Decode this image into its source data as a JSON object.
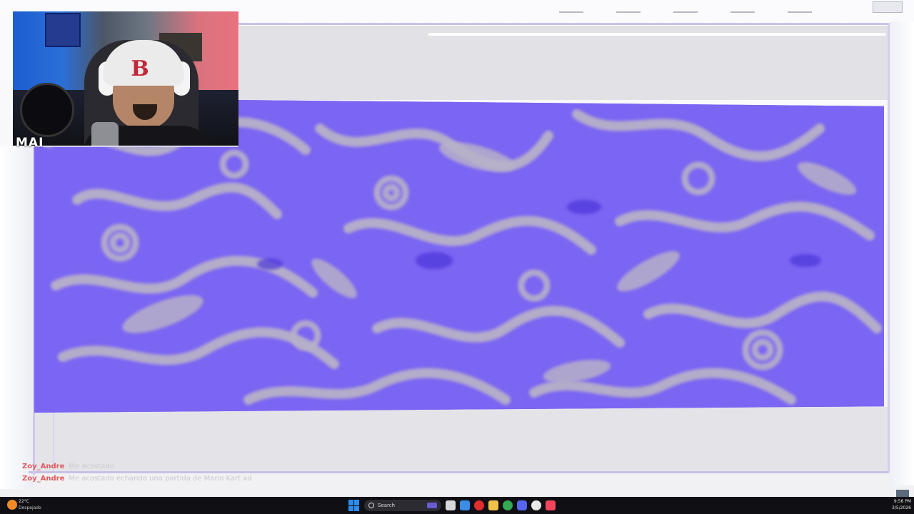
{
  "webcam": {
    "label": "MAI"
  },
  "chat": {
    "messages": [
      {
        "user": "Zoy_Andre",
        "text": "Me acostado"
      },
      {
        "user": "Zoy_Andre",
        "text": "Me acostado echando una partida de Mario Kart xd"
      }
    ]
  },
  "taskbar": {
    "weather": {
      "temp": "22°C",
      "condition": "Despejado"
    },
    "search_label": "Search",
    "apps": [
      "task-view",
      "file-manager",
      "mail",
      "opera",
      "folders",
      "chrome",
      "discord",
      "chatgpt",
      "music"
    ],
    "time": "9:56 PM",
    "date": "3/5/2026"
  },
  "colors": {
    "art_primary": "#7b65f3",
    "art_secondary": "#b9b3c9",
    "accent_start": "#2d8cf0",
    "chat_user": "#e0595d"
  }
}
